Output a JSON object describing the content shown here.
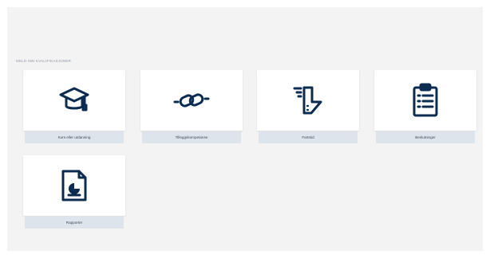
{
  "section": {
    "title": "MELD INN KVALIFIKASJONER"
  },
  "tiles": [
    {
      "label": "Kurs eller utdanning",
      "icon": "graduation-cap-icon"
    },
    {
      "label": "Tilleggskompetanse",
      "icon": "chain-link-icon"
    },
    {
      "label": "Fartstid",
      "icon": "ship-bow-icon"
    },
    {
      "label": "Beslutninger",
      "icon": "clipboard-list-icon"
    },
    {
      "label": "Rapporter",
      "icon": "report-document-icon"
    }
  ],
  "colors": {
    "icon": "#0c2b50",
    "panel_bg": "#f3f3f3",
    "label_bg": "#dde4ec",
    "card_bg": "#ffffff"
  }
}
